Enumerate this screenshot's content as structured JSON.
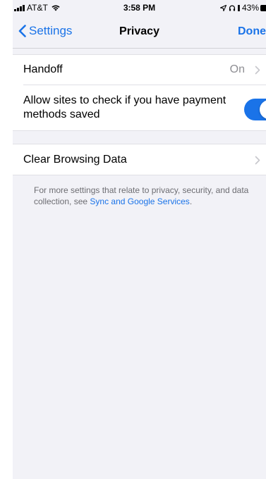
{
  "status_bar": {
    "carrier": "AT&T",
    "time": "3:58 PM",
    "battery_percent": "43%",
    "icons": [
      "signal-bars-icon",
      "wifi-icon",
      "location-arrow-icon",
      "headphones-icon",
      "battery-icon"
    ]
  },
  "nav": {
    "back_label": "Settings",
    "title": "Privacy",
    "done_label": "Done"
  },
  "settings": {
    "handoff": {
      "label": "Handoff",
      "value": "On"
    },
    "payment_methods": {
      "label": "Allow sites to check if you have payment methods saved",
      "enabled": true
    },
    "clear_browsing": {
      "label": "Clear Browsing Data"
    }
  },
  "footer": {
    "text": "For more settings that relate to privacy, security, and data collection, see ",
    "link": "Sync and Google Services",
    "suffix": "."
  },
  "colors": {
    "accent": "#1a73e8",
    "background": "#f2f2f7",
    "secondary_text": "#8e8e93"
  }
}
